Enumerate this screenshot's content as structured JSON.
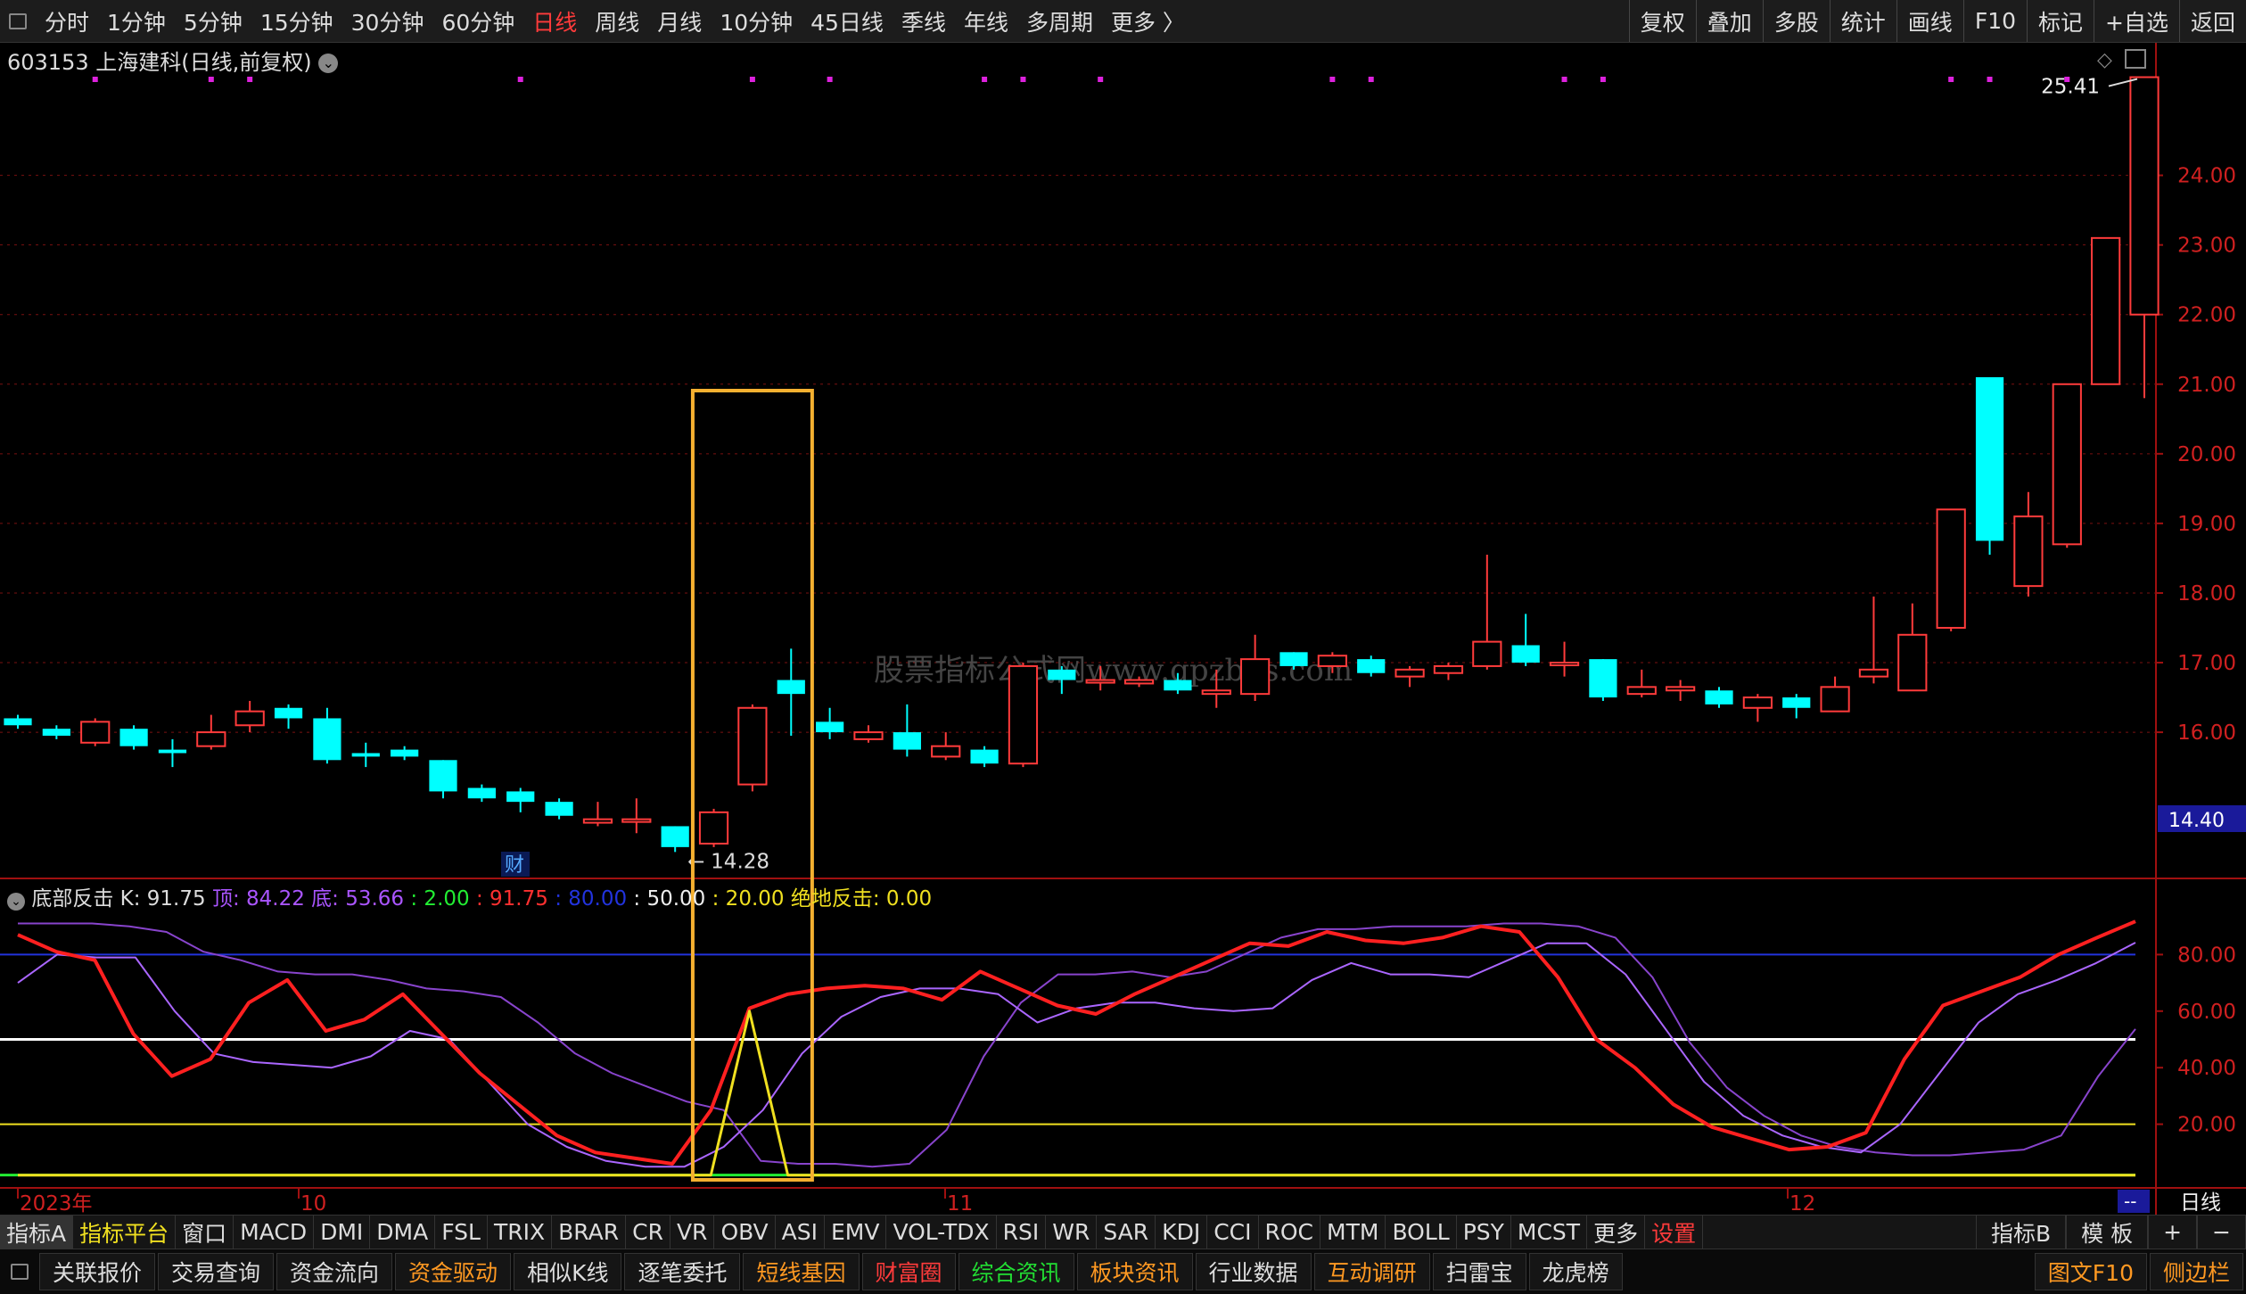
{
  "top_toolbar": {
    "periods": [
      "分时",
      "1分钟",
      "5分钟",
      "15分钟",
      "30分钟",
      "60分钟",
      "日线",
      "周线",
      "月线",
      "10分钟",
      "45日线",
      "季线",
      "年线",
      "多周期",
      "更多 〉"
    ],
    "active_period": "日线",
    "right_buttons": [
      "复权",
      "叠加",
      "多股",
      "统计",
      "画线",
      "F10",
      "标记",
      "+自选",
      "返回"
    ]
  },
  "stock": {
    "code": "603153",
    "name": "上海建科",
    "mode": "(日线,前复权)",
    "high_label": "25.41",
    "low_label": "14.28",
    "current_price_tag": "14.40",
    "cai_badge": "财",
    "watermark": "股票指标公式网www.gpzbgs.com"
  },
  "price_axis": {
    "ticks": [
      "24.00",
      "23.00",
      "22.00",
      "21.00",
      "20.00",
      "19.00",
      "18.00",
      "17.00",
      "16.00"
    ]
  },
  "indicator_header": {
    "name": "底部反击",
    "k_label": "K: 91.75",
    "top_label": "顶: 84.22",
    "bottom_label": "底: 53.66",
    "v1": ": 2.00",
    "v2": ": 91.75",
    "v3": ": 80.00",
    "v4": ": 50.00",
    "v5": ": 20.00",
    "jd_label": "绝地反击: 0.00"
  },
  "indicator_axis": {
    "ticks": [
      "80.00",
      "60.00",
      "40.00",
      "20.00"
    ]
  },
  "date_axis": {
    "labels": [
      "2023年",
      "10",
      "11",
      "12"
    ],
    "period_tag": "日线",
    "dash_tag": "--"
  },
  "indicator_tabs": [
    "指标A",
    "指标平台",
    "窗口",
    "MACD",
    "DMI",
    "DMA",
    "FSL",
    "TRIX",
    "BRAR",
    "CR",
    "VR",
    "OBV",
    "ASI",
    "EMV",
    "VOL-TDX",
    "RSI",
    "WR",
    "SAR",
    "KDJ",
    "CCI",
    "ROC",
    "MTM",
    "BOLL",
    "PSY",
    "MCST",
    "更多",
    "设置"
  ],
  "indicator_tabs_right": [
    "指标B",
    "模 板",
    "+",
    "−"
  ],
  "bottom_bar": {
    "items": [
      {
        "label": "关联报价",
        "color": "white"
      },
      {
        "label": "交易查询",
        "color": "white"
      },
      {
        "label": "资金流向",
        "color": "white"
      },
      {
        "label": "资金驱动",
        "color": "orange"
      },
      {
        "label": "相似K线",
        "color": "white"
      },
      {
        "label": "逐笔委托",
        "color": "white"
      },
      {
        "label": "短线基因",
        "color": "orange"
      },
      {
        "label": "财富圈",
        "color": "red"
      },
      {
        "label": "综合资讯",
        "color": "green"
      },
      {
        "label": "板块资讯",
        "color": "orange"
      },
      {
        "label": "行业数据",
        "color": "white"
      },
      {
        "label": "互动调研",
        "color": "orange"
      },
      {
        "label": "扫雷宝",
        "color": "white"
      },
      {
        "label": "龙虎榜",
        "color": "white"
      }
    ],
    "right": [
      {
        "label": "图文F10",
        "color": "orange"
      },
      {
        "label": "侧边栏",
        "color": "orange"
      }
    ]
  },
  "chart_data": {
    "type": "candlestick",
    "price_range": [
      14.0,
      25.6
    ],
    "candles": [
      {
        "o": 16.2,
        "c": 16.1,
        "h": 16.25,
        "l": 16.05
      },
      {
        "o": 16.05,
        "c": 15.95,
        "h": 16.1,
        "l": 15.9
      },
      {
        "o": 15.85,
        "c": 16.15,
        "h": 16.2,
        "l": 15.8
      },
      {
        "o": 16.05,
        "c": 15.8,
        "h": 16.1,
        "l": 15.75
      },
      {
        "o": 15.75,
        "c": 15.7,
        "h": 15.9,
        "l": 15.5
      },
      {
        "o": 15.8,
        "c": 16.0,
        "h": 16.25,
        "l": 15.75
      },
      {
        "o": 16.1,
        "c": 16.3,
        "h": 16.45,
        "l": 16.0
      },
      {
        "o": 16.35,
        "c": 16.2,
        "h": 16.4,
        "l": 16.05
      },
      {
        "o": 16.2,
        "c": 15.6,
        "h": 16.35,
        "l": 15.55
      },
      {
        "o": 15.7,
        "c": 15.65,
        "h": 15.85,
        "l": 15.5
      },
      {
        "o": 15.75,
        "c": 15.65,
        "h": 15.8,
        "l": 15.6
      },
      {
        "o": 15.6,
        "c": 15.15,
        "h": 15.6,
        "l": 15.05
      },
      {
        "o": 15.2,
        "c": 15.05,
        "h": 15.25,
        "l": 15.0
      },
      {
        "o": 15.15,
        "c": 15.0,
        "h": 15.2,
        "l": 14.85
      },
      {
        "o": 15.0,
        "c": 14.8,
        "h": 15.05,
        "l": 14.75
      },
      {
        "o": 14.7,
        "c": 14.75,
        "h": 15.0,
        "l": 14.65
      },
      {
        "o": 14.75,
        "c": 14.75,
        "h": 15.05,
        "l": 14.55
      },
      {
        "o": 14.65,
        "c": 14.35,
        "h": 14.65,
        "l": 14.28
      },
      {
        "o": 14.4,
        "c": 14.85,
        "h": 14.9,
        "l": 14.35
      },
      {
        "o": 15.25,
        "c": 16.35,
        "h": 16.4,
        "l": 15.15
      },
      {
        "o": 16.75,
        "c": 16.55,
        "h": 17.2,
        "l": 15.95
      },
      {
        "o": 16.15,
        "c": 16.0,
        "h": 16.35,
        "l": 15.9
      },
      {
        "o": 15.9,
        "c": 16.0,
        "h": 16.1,
        "l": 15.85
      },
      {
        "o": 16.0,
        "c": 15.75,
        "h": 16.4,
        "l": 15.65
      },
      {
        "o": 15.65,
        "c": 15.8,
        "h": 16.0,
        "l": 15.6
      },
      {
        "o": 15.75,
        "c": 15.55,
        "h": 15.8,
        "l": 15.5
      },
      {
        "o": 15.55,
        "c": 16.95,
        "h": 17.0,
        "l": 15.5
      },
      {
        "o": 16.9,
        "c": 16.75,
        "h": 16.95,
        "l": 16.55
      },
      {
        "o": 16.75,
        "c": 16.75,
        "h": 16.95,
        "l": 16.6
      },
      {
        "o": 16.7,
        "c": 16.75,
        "h": 16.8,
        "l": 16.65
      },
      {
        "o": 16.75,
        "c": 16.6,
        "h": 16.85,
        "l": 16.55
      },
      {
        "o": 16.55,
        "c": 16.6,
        "h": 16.9,
        "l": 16.35
      },
      {
        "o": 16.55,
        "c": 17.05,
        "h": 17.4,
        "l": 16.45
      },
      {
        "o": 17.15,
        "c": 16.95,
        "h": 17.15,
        "l": 16.9
      },
      {
        "o": 16.95,
        "c": 17.1,
        "h": 17.15,
        "l": 16.85
      },
      {
        "o": 17.05,
        "c": 16.85,
        "h": 17.1,
        "l": 16.8
      },
      {
        "o": 16.8,
        "c": 16.9,
        "h": 16.95,
        "l": 16.65
      },
      {
        "o": 16.85,
        "c": 16.95,
        "h": 17.0,
        "l": 16.75
      },
      {
        "o": 16.95,
        "c": 17.3,
        "h": 18.55,
        "l": 16.9
      },
      {
        "o": 17.25,
        "c": 17.0,
        "h": 17.7,
        "l": 16.95
      },
      {
        "o": 17.0,
        "c": 17.0,
        "h": 17.3,
        "l": 16.8
      },
      {
        "o": 17.05,
        "c": 16.5,
        "h": 17.05,
        "l": 16.45
      },
      {
        "o": 16.55,
        "c": 16.65,
        "h": 16.9,
        "l": 16.5
      },
      {
        "o": 16.6,
        "c": 16.65,
        "h": 16.75,
        "l": 16.45
      },
      {
        "o": 16.6,
        "c": 16.4,
        "h": 16.65,
        "l": 16.35
      },
      {
        "o": 16.35,
        "c": 16.5,
        "h": 16.55,
        "l": 16.15
      },
      {
        "o": 16.5,
        "c": 16.35,
        "h": 16.55,
        "l": 16.2
      },
      {
        "o": 16.3,
        "c": 16.65,
        "h": 16.8,
        "l": 16.3
      },
      {
        "o": 16.8,
        "c": 16.9,
        "h": 17.95,
        "l": 16.7
      },
      {
        "o": 16.6,
        "c": 17.4,
        "h": 17.85,
        "l": 16.6
      },
      {
        "o": 17.5,
        "c": 19.2,
        "h": 19.2,
        "l": 17.45
      },
      {
        "o": 21.1,
        "c": 18.75,
        "h": 21.1,
        "l": 18.55
      },
      {
        "o": 18.1,
        "c": 19.1,
        "h": 19.45,
        "l": 17.95
      },
      {
        "o": 18.7,
        "c": 21.0,
        "h": 21.0,
        "l": 18.65
      },
      {
        "o": 21.0,
        "c": 23.1,
        "h": 23.1,
        "l": 21.0
      },
      {
        "o": 22.0,
        "c": 25.41,
        "h": 25.41,
        "l": 20.8
      }
    ],
    "indicator": {
      "range": [
        0,
        100
      ],
      "levels": {
        "level_80": 80,
        "level_50": 50,
        "level_20": 20,
        "level_2": 2
      },
      "red_line": [
        87,
        81,
        78,
        52,
        37,
        43,
        63,
        71,
        53,
        57,
        66,
        52,
        38,
        27,
        16,
        10,
        8,
        6,
        25,
        61,
        66,
        68,
        69,
        68,
        64,
        74,
        68,
        62,
        59,
        66,
        72,
        78,
        84,
        83,
        88,
        85,
        84,
        86,
        90,
        88,
        72,
        50,
        40,
        27,
        19,
        15,
        11,
        12,
        17,
        43,
        62,
        67,
        72,
        80,
        86,
        91.75
      ],
      "purple_bright": [
        70,
        80,
        79,
        79,
        60,
        45,
        42,
        41,
        40,
        44,
        53,
        50,
        35,
        20,
        12,
        7,
        5,
        5,
        12,
        25,
        45,
        58,
        65,
        68,
        68,
        66,
        56,
        61,
        63,
        63,
        61,
        60,
        61,
        71,
        77,
        73,
        73,
        72,
        78,
        84,
        84,
        73,
        54,
        35,
        23,
        16,
        12,
        10,
        20,
        38,
        56,
        66,
        71,
        77,
        84.22
      ],
      "purple_dark": [
        91,
        91,
        91,
        90,
        88,
        81,
        78,
        74,
        73,
        73,
        71,
        68,
        67,
        65,
        56,
        45,
        38,
        33,
        28,
        25,
        7,
        6,
        6,
        5,
        6,
        18,
        44,
        63,
        73,
        73,
        74,
        72,
        74,
        80,
        86,
        89,
        89,
        90,
        90,
        90,
        91,
        91,
        90,
        86,
        72,
        49,
        33,
        23,
        16,
        12,
        10,
        9,
        9,
        10,
        11,
        16,
        37,
        53.66
      ],
      "yellow_signal": {
        "values": [
          2,
          2,
          2,
          2,
          2,
          2,
          2,
          2,
          2,
          2,
          2,
          2,
          2,
          2,
          2,
          2,
          2,
          2,
          2,
          60,
          2,
          2,
          2,
          2,
          2,
          2,
          2,
          2,
          2,
          2,
          2,
          2,
          2,
          2,
          2,
          2,
          2,
          2,
          2,
          2,
          2,
          2,
          2,
          2,
          2,
          2,
          2,
          2,
          2,
          2,
          2,
          2,
          2,
          2,
          2,
          2
        ],
        "peak_index": 19
      }
    },
    "highlight_box": {
      "from_index": 18,
      "to_index": 20
    },
    "magenta_dots": [
      2,
      5,
      6,
      13,
      19,
      21,
      25,
      26,
      28,
      34,
      35,
      40,
      41,
      50,
      51,
      53
    ]
  }
}
